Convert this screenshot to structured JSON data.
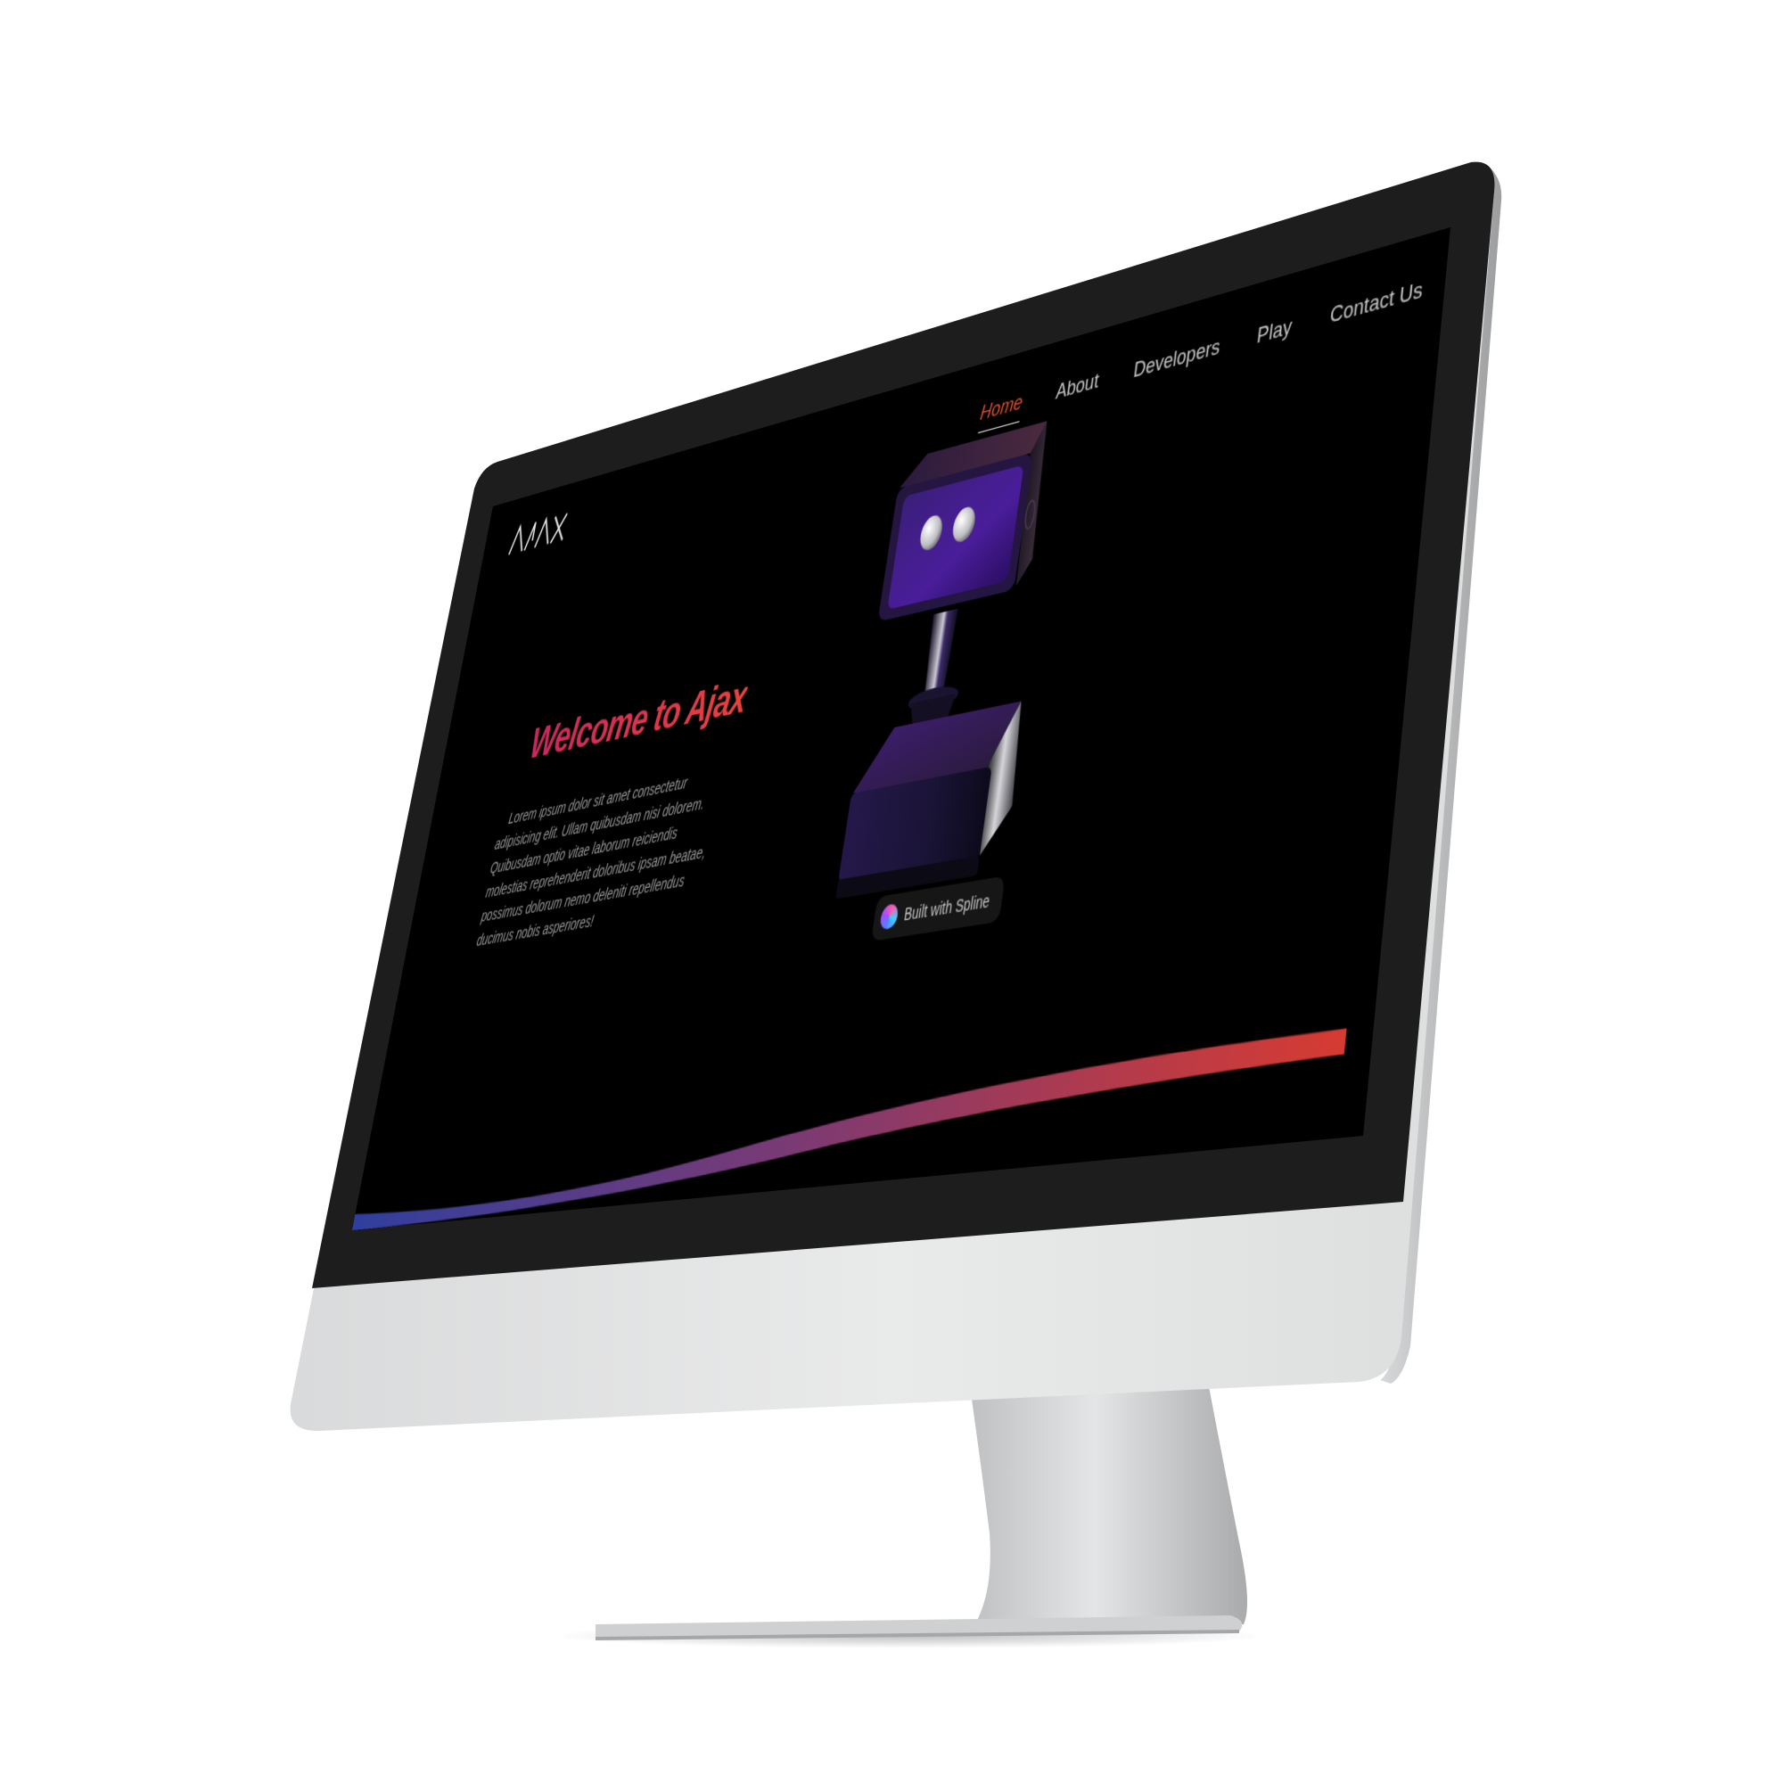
{
  "site": {
    "logo_text": "AJAX",
    "nav": [
      {
        "label": "Home",
        "active": true
      },
      {
        "label": "About",
        "active": false
      },
      {
        "label": "Developers",
        "active": false
      },
      {
        "label": "Play",
        "active": false
      },
      {
        "label": "Contact Us",
        "active": false
      }
    ],
    "hero": {
      "title": "Welcome to Ajax",
      "body": "Lorem ipsum dolor sit amet consectetur adipisicing elit. Ullam quibusdam nisi dolorem. Quibusdam optio vitae laborum reiciendis molestias reprehenderit doloribus ipsam beatae, possimus dolorum nemo deleniti repellendus ducimus nobis asperiores!"
    },
    "spline_badge": "Built with Spline"
  },
  "colors": {
    "page_background": "#000000",
    "nav_active": "#e0502c",
    "title_gradient": [
      "#c9275f",
      "#e8423e"
    ],
    "wave_gradient": [
      "#2f3f9e",
      "#7a3a74",
      "#d63b32"
    ]
  }
}
